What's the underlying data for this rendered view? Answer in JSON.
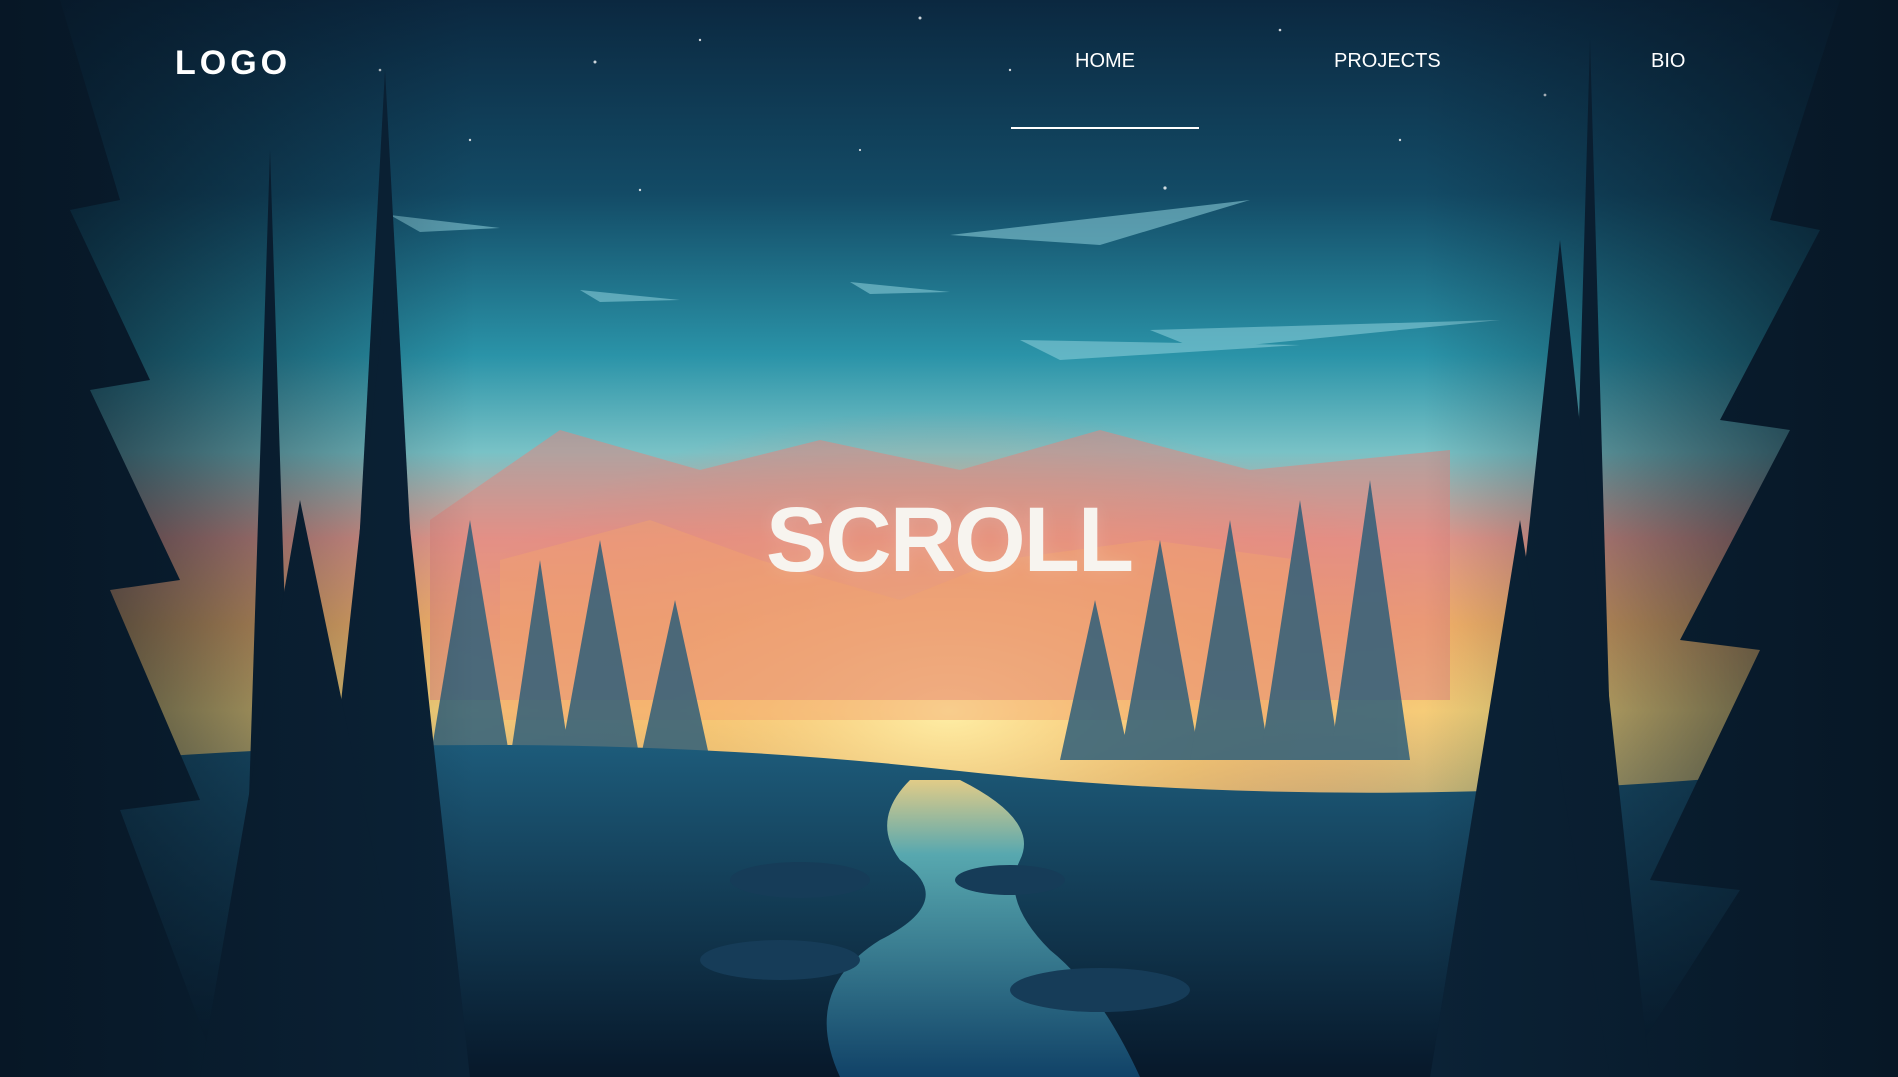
{
  "brand": {
    "logo_text": "LOGO"
  },
  "nav": {
    "items": [
      {
        "label": "HOME",
        "active": true
      },
      {
        "label": "PROJECTS",
        "active": false
      },
      {
        "label": "BIO",
        "active": false
      }
    ]
  },
  "hero": {
    "title": "SCROLL"
  },
  "colors": {
    "sky_top": "#0c2a44",
    "sky_mid": "#2fa3b3",
    "glow": "#f6c75a",
    "sunset": "#f07a6a",
    "forest_dark": "#07182a",
    "river": "#1e5f8f",
    "text": "#ffffff"
  }
}
